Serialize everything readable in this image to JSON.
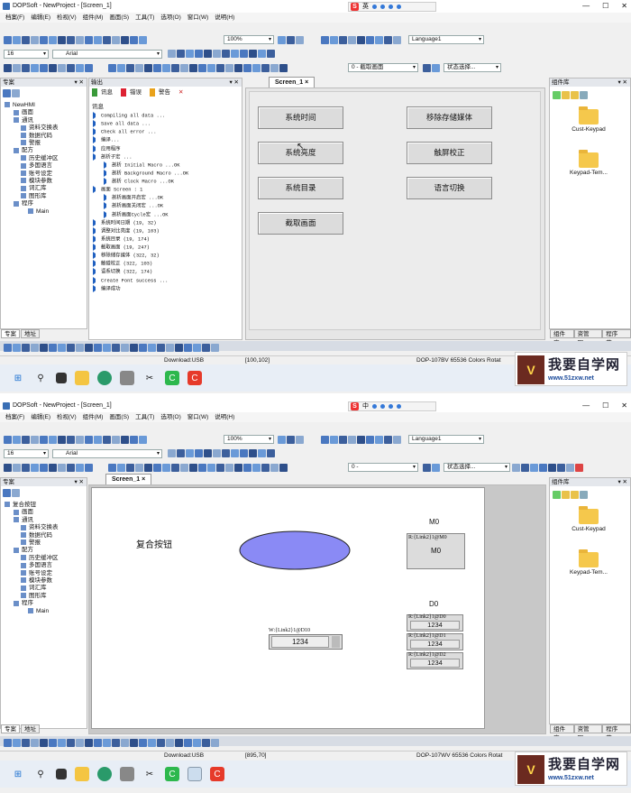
{
  "shot1": {
    "title": "DOPSoft - NewProject - [Screen_1]",
    "ime_char": "英",
    "menu": [
      "档案(F)",
      "编辑(E)",
      "检视(V)",
      "组件(M)",
      "画面(S)",
      "工具(T)",
      "选项(O)",
      "窗口(W)",
      "说明(H)"
    ],
    "zoom": "100%",
    "language": "Language1",
    "font_size": "16",
    "font_name": "Arial",
    "screen_combo": "0 - 截取画面",
    "state_label": "状态选择...",
    "project_panel_title": "专案",
    "tree": [
      "NewHMI",
      "画面",
      "通讯",
      "资料交换表",
      "数据代码",
      "警报",
      "配方",
      "历史缓冲区",
      "多国语言",
      "账号设定",
      "模块参数",
      "词汇库",
      "图形库",
      "程序",
      "Main"
    ],
    "left_tabs": [
      "专案",
      "地址"
    ],
    "output_panel_title": "输出",
    "output_tabs": [
      "讯息",
      "错误",
      "警告"
    ],
    "output_header": "讯息",
    "output_lines": [
      "Compiling all data ...",
      "Save all data ...",
      "Check all error ...",
      "编译...",
      "应用程序",
      "剖析子宏 ...",
      "剖析 Initial Macro ...OK",
      "剖析 Background Macro ...OK",
      "剖析 Clock Macro ...OK",
      "画面 Screen : 1",
      "剖析画面开启宏 ...OK",
      "剖析画面关闭宏 ...OK",
      "剖析画面Cycle宏 ...OK",
      "系统时间日期 (19, 32)",
      "调整对比亮度 (19, 103)",
      "系统目录 (19, 174)",
      "截取画面 (19, 247)",
      "移除储存媒体 (322, 32)",
      "触碰校正 (322, 103)",
      "语系切换 (322, 174)",
      "Create Font success ...",
      "编译成功"
    ],
    "screen_tab": "Screen_1",
    "buttons": [
      "系统时间",
      "移除存储媒体",
      "系统亮度",
      "触屏校正",
      "系统目录",
      "语言切换",
      "截取画面"
    ],
    "library_title": "组件库",
    "library_items": [
      "Cust-Keypad",
      "Keypad-Tem..."
    ],
    "right_tabs": [
      "组件库",
      "资管理...",
      "程序范..."
    ],
    "status_download": "Download:USB",
    "status_coord": "[100,102]",
    "status_model": "DOP-107BV 65536 Colors Rotat"
  },
  "shot2": {
    "title": "DOPSoft - NewProject - [Screen_1]",
    "ime_char": "中",
    "menu": [
      "档案(F)",
      "编辑(E)",
      "检视(V)",
      "组件(M)",
      "画面(S)",
      "工具(T)",
      "选项(O)",
      "窗口(W)",
      "说明(H)"
    ],
    "zoom": "100%",
    "language": "Language1",
    "font_size": "16",
    "font_name": "Arial",
    "screen_combo": "0 -",
    "state_label": "状态选择...",
    "project_panel_title": "专案",
    "tree": [
      "复合按钮",
      "画面",
      "通讯",
      "资料交换表",
      "数据代码",
      "警报",
      "配方",
      "历史缓冲区",
      "多国语言",
      "账号设定",
      "模块参数",
      "词汇库",
      "图形库",
      "程序",
      "Main"
    ],
    "left_tabs": [
      "专案",
      "地址"
    ],
    "screen_tab": "Screen_1",
    "canvas_title": "复合按钮",
    "m0_label": "M0",
    "m0_addr": "R:{Link2}1@M0",
    "m0_btn": "M0",
    "d0_label": "D0",
    "numinput_addr": "W:{Link2}1@D10",
    "numinput_val": "1234",
    "d_rows": [
      {
        "addr": "R:{Link2}1@D0",
        "val": "1234"
      },
      {
        "addr": "R:{Link2}1@D1",
        "val": "1234"
      },
      {
        "addr": "R:{Link2}1@D2",
        "val": "1234"
      }
    ],
    "library_title": "组件库",
    "library_items": [
      "Cust-Keypad",
      "Keypad-Tem..."
    ],
    "right_tabs": [
      "组件库",
      "资管理...",
      "程序范..."
    ],
    "status_download": "Download:USB",
    "status_coord": "[895,70]",
    "status_model": "DOP-107WV 65536 Colors Rotat"
  },
  "watermark": {
    "brand": "我要自学网",
    "url": "www.51zxw.net"
  },
  "colors": {
    "ellipse": "#8a8af5",
    "panel_head": "#e4e7ec",
    "button": "#dcdcdc",
    "taskbar": "#e8eef6"
  }
}
